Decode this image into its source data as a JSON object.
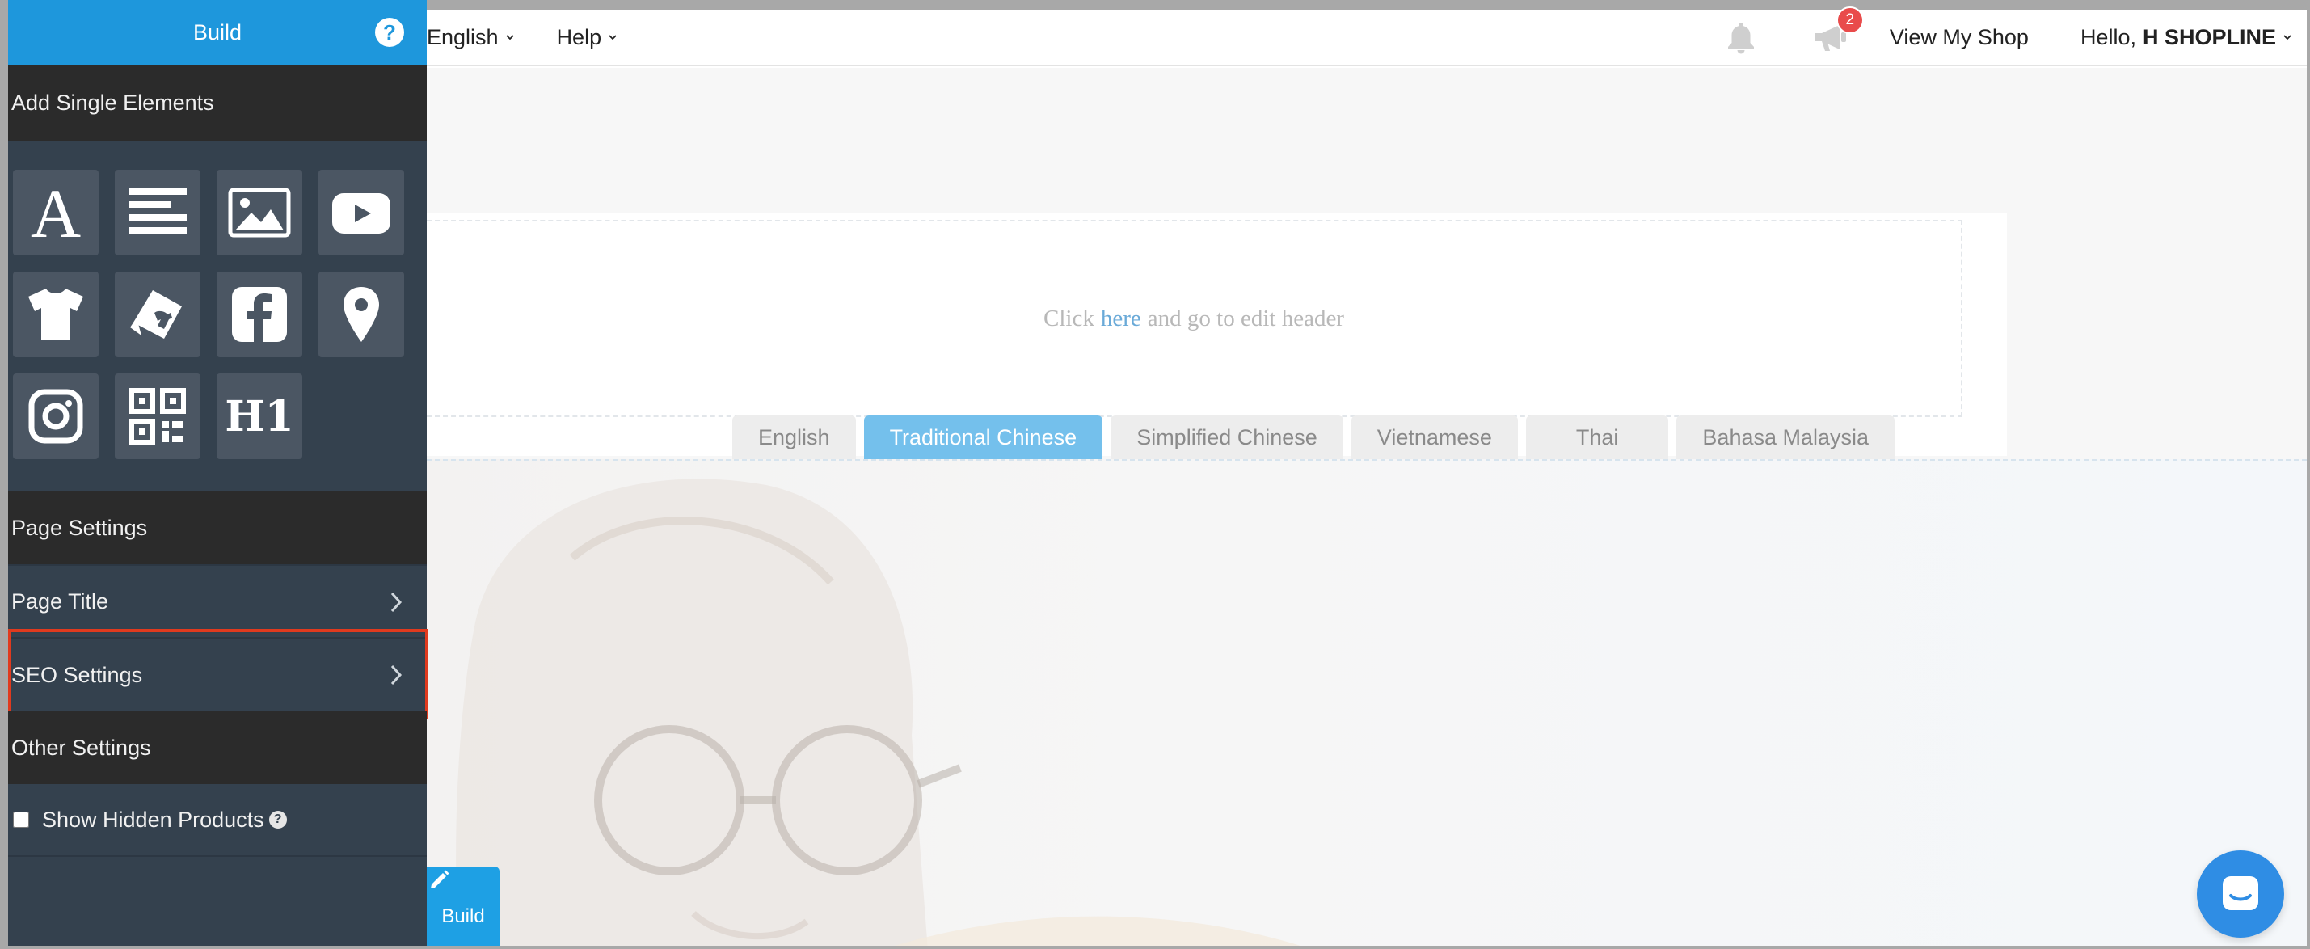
{
  "topbar": {
    "language_menu": "English",
    "help_menu": "Help",
    "notifications_badge": "2",
    "view_shop": "View My Shop",
    "hello_prefix": "Hello,",
    "hello_name": "H SHOPLINE"
  },
  "sidebar": {
    "header_title": "Build",
    "help_symbol": "?",
    "add_elements_title": "Add Single Elements",
    "elements": [
      "text-icon",
      "paragraph-icon",
      "image-icon",
      "youtube-icon",
      "tshirt-icon",
      "product-tag-icon",
      "facebook-icon",
      "map-pin-icon",
      "instagram-icon",
      "qr-code-icon",
      "h1-icon"
    ],
    "page_settings_title": "Page Settings",
    "page_title_label": "Page Title",
    "seo_settings_label": "SEO Settings",
    "other_settings_title": "Other Settings",
    "show_hidden_products_label": "Show Hidden Products",
    "show_hidden_products_checked": false,
    "tooltip_symbol": "?"
  },
  "canvas": {
    "header_text_before": "Click",
    "header_link": "here",
    "header_text_after": "and go to edit header",
    "language_tabs": [
      "English",
      "Traditional Chinese",
      "Simplified Chinese",
      "Vietnamese",
      "Thai",
      "Bahasa Malaysia"
    ],
    "active_tab": "Traditional Chinese",
    "build_button": "Build"
  },
  "colors": {
    "sidebar_bg": "#34414e",
    "sidebar_section_bg": "#2b2b2b",
    "accent_blue": "#1e97dc",
    "active_tab_bg": "#74c0ec",
    "highlight_red": "#e03a1e",
    "badge_red": "#e94b4b",
    "chat_blue": "#2f8de4"
  }
}
